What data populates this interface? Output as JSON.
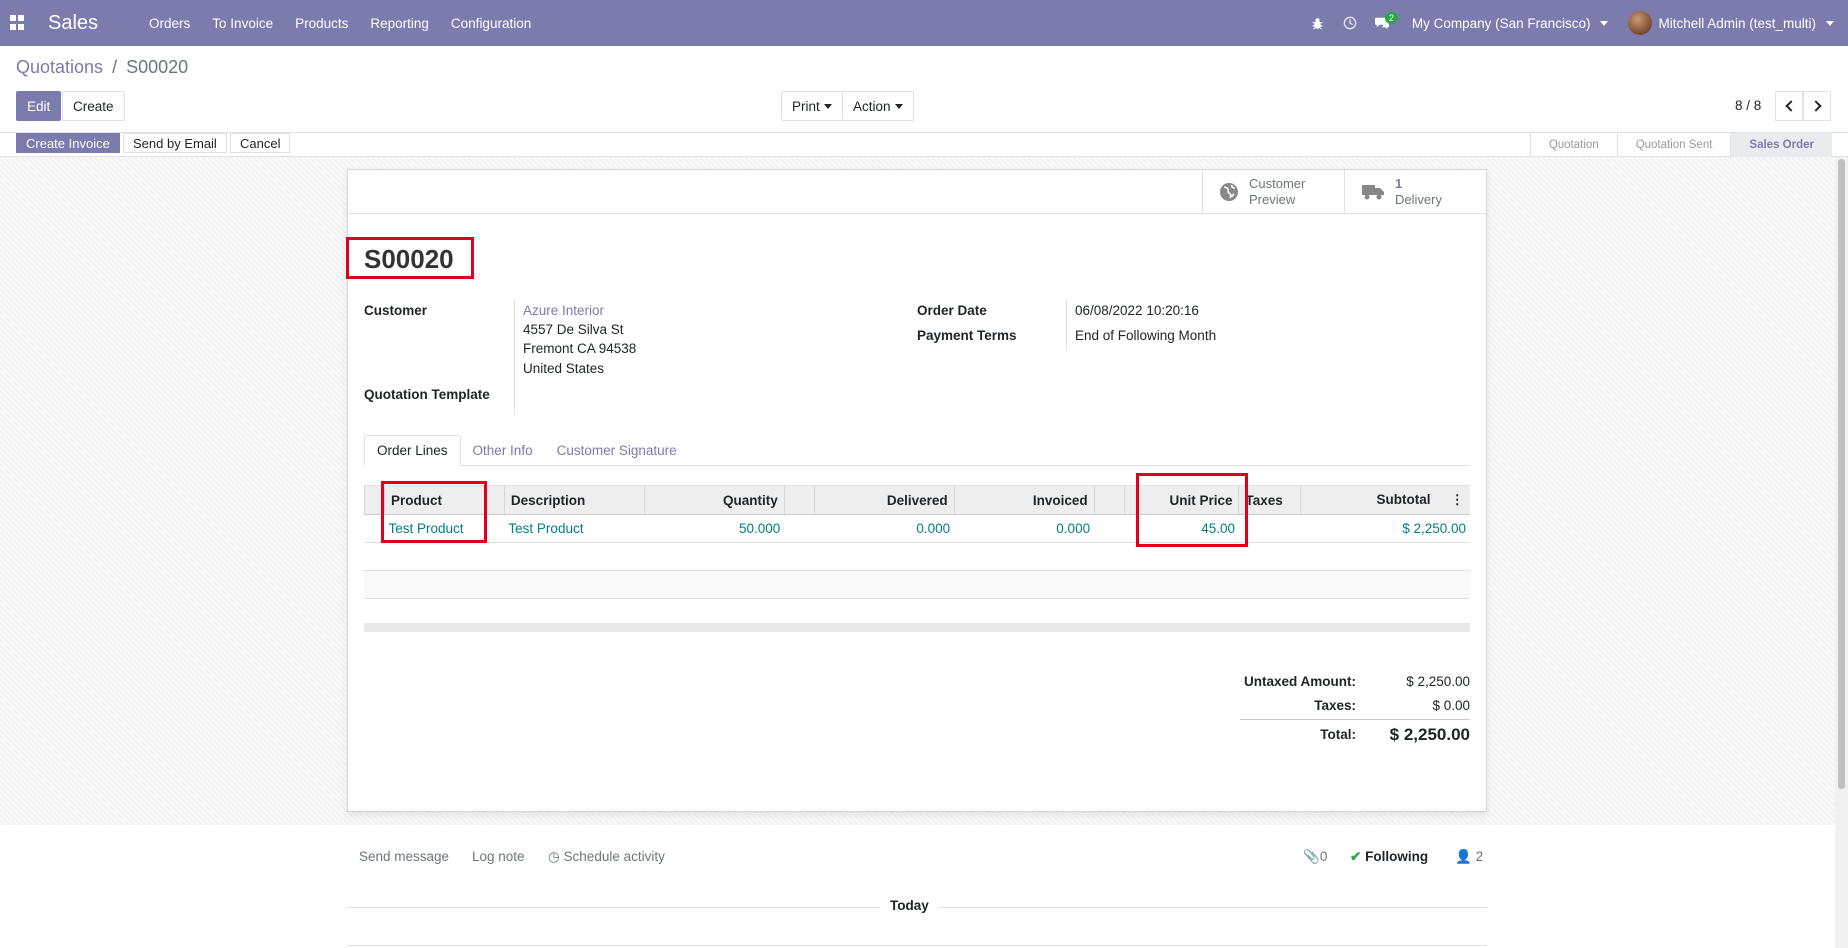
{
  "navbar": {
    "app_name": "Sales",
    "menu": [
      "Orders",
      "To Invoice",
      "Products",
      "Reporting",
      "Configuration"
    ],
    "messages_count": "2",
    "company": "My Company (San Francisco)",
    "user": "Mitchell Admin (test_multi)"
  },
  "breadcrumb": {
    "parent": "Quotations",
    "separator": "/",
    "current": "S00020"
  },
  "toolbar": {
    "edit": "Edit",
    "create": "Create",
    "print": "Print",
    "action": "Action",
    "pager": "8 / 8"
  },
  "statusbar": {
    "buttons": [
      "Create Invoice",
      "Send by Email",
      "Cancel"
    ],
    "stages": [
      "Quotation",
      "Quotation Sent",
      "Sales Order"
    ],
    "active_stage": "Sales Order"
  },
  "smart_buttons": {
    "preview_line1": "Customer",
    "preview_line2": "Preview",
    "delivery_count": "1",
    "delivery_label": "Delivery"
  },
  "order": {
    "name": "S00020",
    "customer_label": "Customer",
    "customer_name": "Azure Interior",
    "address_line1": "4557 De Silva St",
    "address_line2": "Fremont CA 94538",
    "address_line3": "United States",
    "template_label": "Quotation Template",
    "order_date_label": "Order Date",
    "order_date": "06/08/2022 10:20:16",
    "payment_terms_label": "Payment Terms",
    "payment_terms": "End of Following Month"
  },
  "tabs": [
    "Order Lines",
    "Other Info",
    "Customer Signature"
  ],
  "lines": {
    "headers": {
      "product": "Product",
      "description": "Description",
      "quantity": "Quantity",
      "delivered": "Delivered",
      "invoiced": "Invoiced",
      "unit_price": "Unit Price",
      "taxes": "Taxes",
      "subtotal": "Subtotal"
    },
    "rows": [
      {
        "product": "Test Product",
        "description": "Test Product",
        "quantity": "50.000",
        "delivered": "0.000",
        "invoiced": "0.000",
        "unit_price": "45.00",
        "taxes": "",
        "subtotal": "$ 2,250.00"
      }
    ]
  },
  "totals": {
    "untaxed_label": "Untaxed Amount:",
    "untaxed": "$ 2,250.00",
    "taxes_label": "Taxes:",
    "taxes": "$ 0.00",
    "total_label": "Total:",
    "total": "$ 2,250.00"
  },
  "chatter": {
    "send_message": "Send message",
    "log_note": "Log note",
    "schedule_activity": "Schedule activity",
    "attachments": "0",
    "following": "Following",
    "followers": "2",
    "today": "Today"
  },
  "colors": {
    "brand": "#7c7bad",
    "link": "#017e84",
    "highlight": "#e0001b"
  }
}
